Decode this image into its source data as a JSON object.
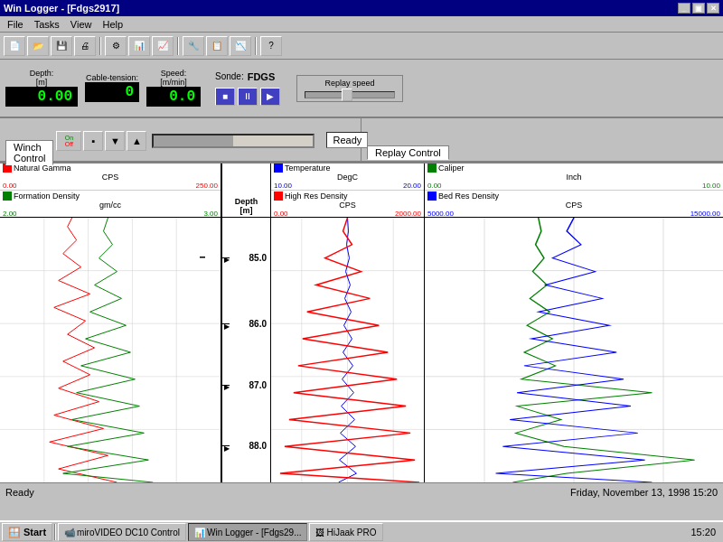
{
  "window": {
    "title": "Win Logger - [Fdgs2917]"
  },
  "menu": {
    "items": [
      "File",
      "Tasks",
      "View",
      "Help"
    ]
  },
  "instruments": {
    "depth_label": "Depth:",
    "depth_unit": "[m]",
    "depth_value": "0.00",
    "cable_label": "Cable-tension:",
    "cable_value": "0",
    "speed_label": "Speed:",
    "speed_unit": "[m/min]",
    "speed_value": "0.0",
    "sonde_label": "Sonde:",
    "sonde_value": "FDGS",
    "replay_label": "Replay speed"
  },
  "transport": {
    "stop": "■",
    "pause": "⏸",
    "play": "▶"
  },
  "tabs": {
    "winch": "Winch Control",
    "replay": "Replay Control",
    "winch_status": "Ready"
  },
  "tracks": {
    "left": {
      "track1": {
        "name": "Natural Gamma",
        "unit": "CPS",
        "color": "red",
        "scale_min": "0.00",
        "scale_max": "250.00"
      },
      "track2": {
        "name": "Formation Density",
        "unit": "gm/cc",
        "color": "green",
        "scale_min": "2.00",
        "scale_max": "3.00"
      }
    },
    "depth": {
      "name": "Depth",
      "unit": "[m]",
      "marks": [
        "85.0",
        "86.0",
        "87.0",
        "88.0"
      ]
    },
    "middle": {
      "track1": {
        "name": "Temperature",
        "unit": "DegC",
        "color": "blue",
        "scale_min": "10.00",
        "scale_max": "20.00"
      },
      "track2": {
        "name": "High Res Density",
        "unit": "CPS",
        "color": "red",
        "scale_min": "0.00",
        "scale_max": "2000.00"
      }
    },
    "right": {
      "track1": {
        "name": "Caliper",
        "unit": "Inch",
        "color": "green",
        "scale_min": "0.00",
        "scale_max": "10.00"
      },
      "track2": {
        "name": "Bed Res Density",
        "unit": "CPS",
        "color": "blue",
        "scale_min": "5000.00",
        "scale_max": "15000.00"
      }
    }
  },
  "statusbar": {
    "left": "Ready",
    "right": "Friday, November 13, 1998     15:20"
  },
  "taskbar": {
    "start": "Start",
    "items": [
      {
        "label": "miroVIDEO DC10 Control",
        "active": false
      },
      {
        "label": "Win Logger - [Fdgs29...",
        "active": true
      },
      {
        "label": "HiJaak PRO",
        "active": false
      }
    ],
    "time": "15:20"
  }
}
